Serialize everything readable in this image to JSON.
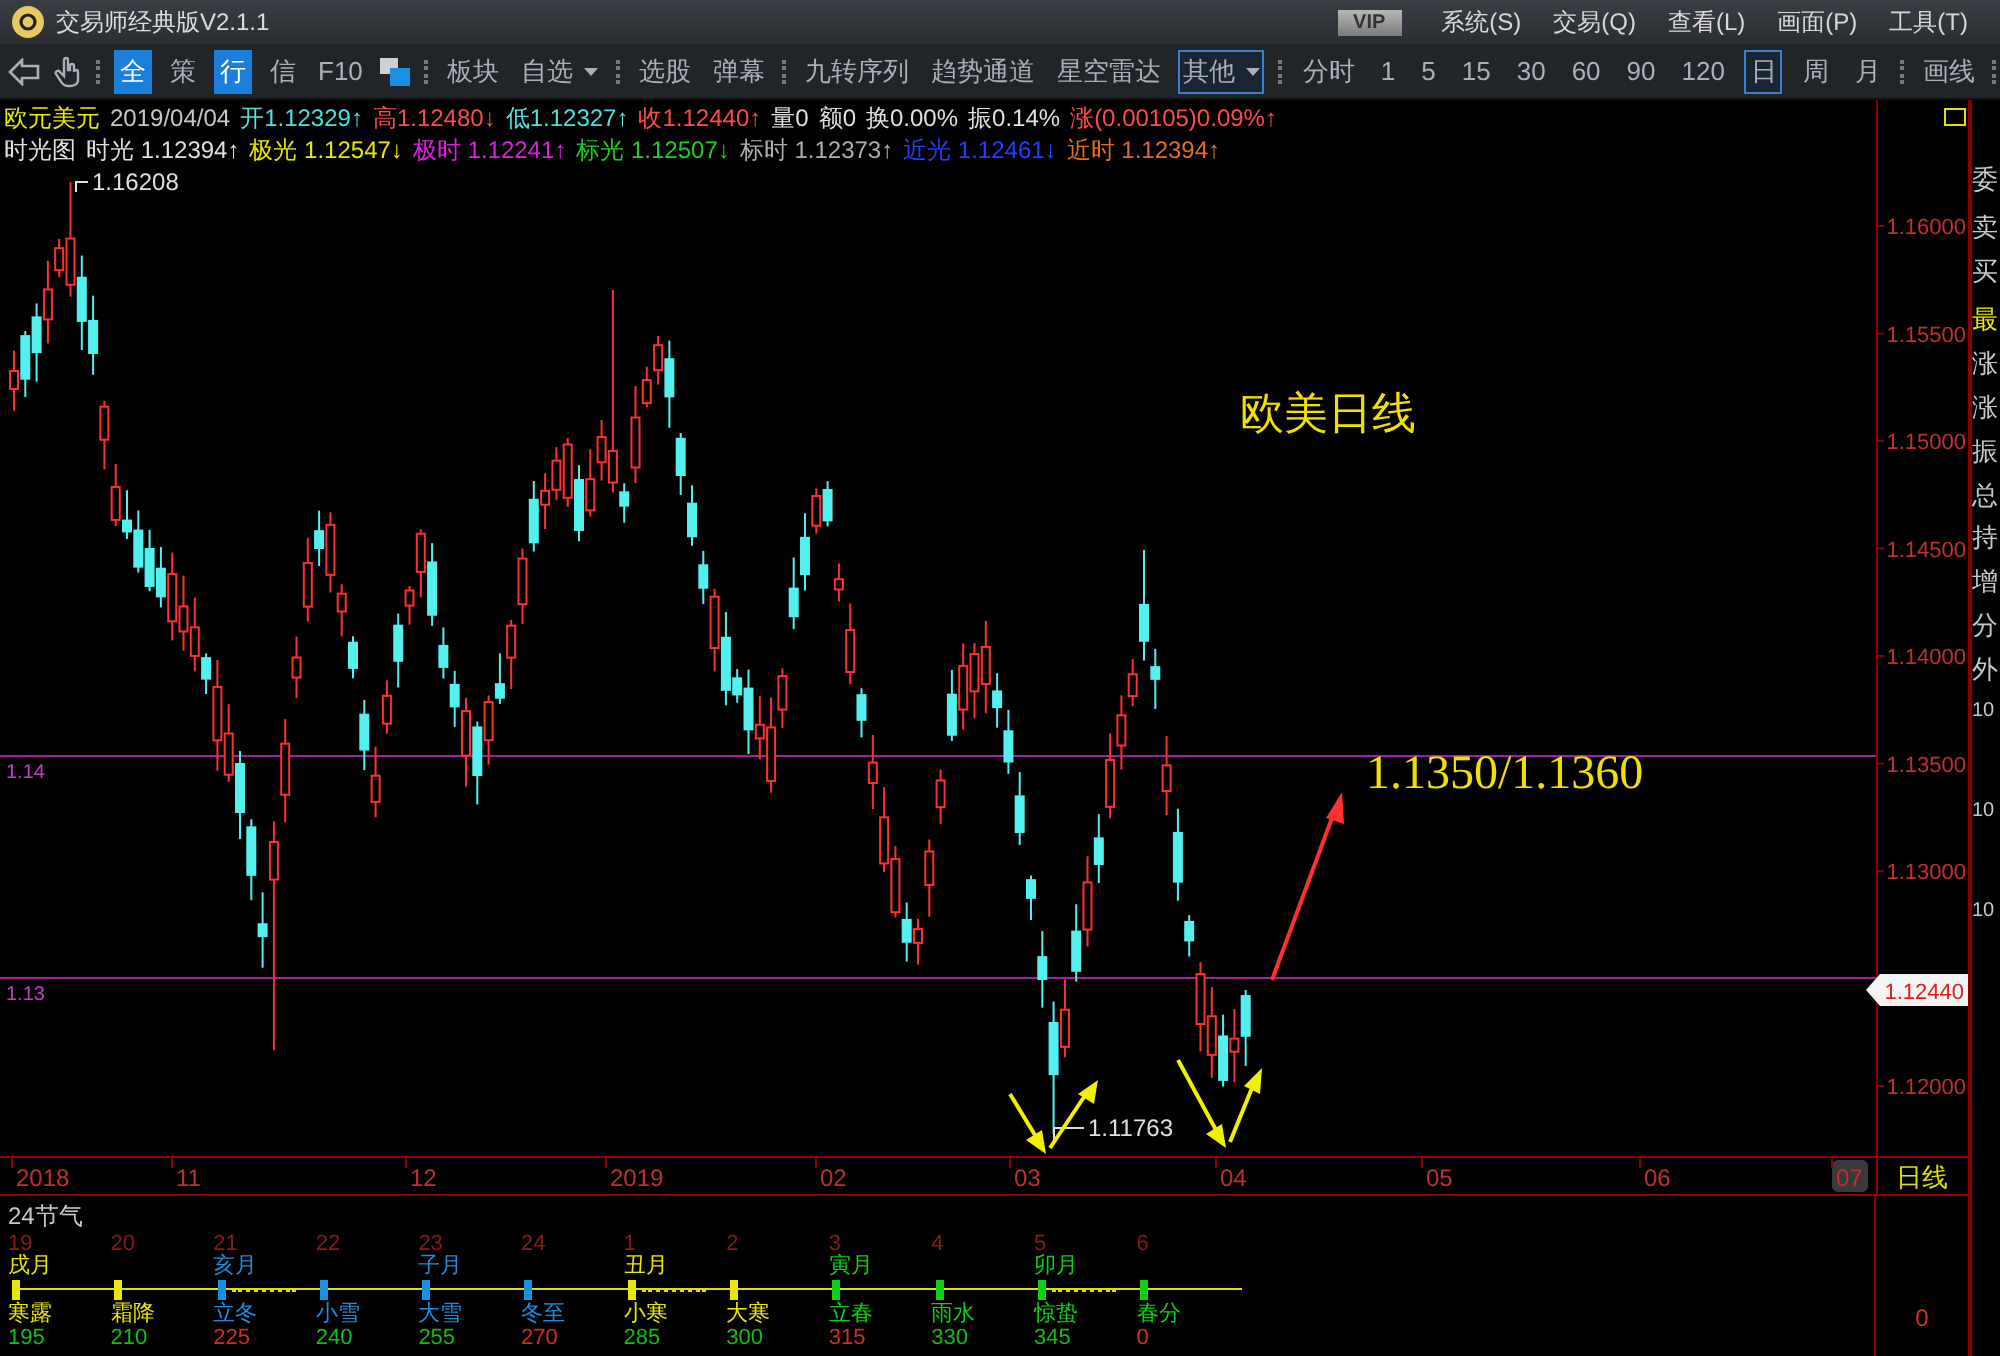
{
  "title_bar": {
    "title": "交易师经典版V2.1.1",
    "badge": "VIP",
    "menus": [
      "系统(S)",
      "交易(Q)",
      "查看(L)",
      "画面(P)",
      "工具(T)"
    ]
  },
  "toolbar": {
    "quick": [
      {
        "text": "全",
        "boxed": true
      },
      {
        "text": "策",
        "boxed": false
      },
      {
        "text": "行",
        "boxed": true
      },
      {
        "text": "信",
        "boxed": false
      },
      {
        "text": "F10",
        "boxed": false
      }
    ],
    "groups": [
      [
        {
          "text": "板块",
          "kind": "button",
          "selected": false
        },
        {
          "text": "自选",
          "kind": "dropdown",
          "selected": false
        }
      ],
      [
        {
          "text": "选股",
          "kind": "button",
          "selected": false
        },
        {
          "text": "弹幕",
          "kind": "button",
          "selected": false
        }
      ],
      [
        {
          "text": "九转序列",
          "kind": "button",
          "selected": false
        },
        {
          "text": "趋势通道",
          "kind": "button",
          "selected": false
        },
        {
          "text": "星空雷达",
          "kind": "button",
          "selected": false
        },
        {
          "text": "其他",
          "kind": "dropdown",
          "selected": true
        }
      ]
    ],
    "periods": [
      {
        "text": "分时",
        "selected": false
      },
      {
        "text": "1",
        "selected": false
      },
      {
        "text": "5",
        "selected": false
      },
      {
        "text": "15",
        "selected": false
      },
      {
        "text": "30",
        "selected": false
      },
      {
        "text": "60",
        "selected": false
      },
      {
        "text": "90",
        "selected": false
      },
      {
        "text": "120",
        "selected": false
      },
      {
        "text": "日",
        "selected": true
      },
      {
        "text": "周",
        "selected": false
      },
      {
        "text": "月",
        "selected": false
      }
    ],
    "draw": "画线"
  },
  "quote_line": [
    {
      "text": "欧元美元",
      "color": "#e8e800"
    },
    {
      "text": "2019/04/04",
      "color": "#c8c8c8"
    },
    {
      "text": "开1.12329↑",
      "color": "#4fe0e0"
    },
    {
      "text": "高1.12480↓",
      "color": "#ff4a4a"
    },
    {
      "text": "低1.12327↑",
      "color": "#4fe0e0"
    },
    {
      "text": "收1.12440↑",
      "color": "#ff4a4a"
    },
    {
      "text": "量0",
      "color": "#e0e0e0"
    },
    {
      "text": "额0",
      "color": "#e0e0e0"
    },
    {
      "text": "换0.00%",
      "color": "#e0e0e0"
    },
    {
      "text": "振0.14%",
      "color": "#e0e0e0"
    },
    {
      "text": "涨(0.00105)0.09%↑",
      "color": "#ff4a4a"
    }
  ],
  "indicator_line": [
    {
      "text": "时光图",
      "color": "#e0e0e0"
    },
    {
      "text": "时光 1.12394↑",
      "color": "#e0e0e0"
    },
    {
      "text": "极光 1.12547↓",
      "color": "#e8e800"
    },
    {
      "text": "极时 1.12241↑",
      "color": "#e020e0"
    },
    {
      "text": "标光 1.12507↓",
      "color": "#20d020"
    },
    {
      "text": "标时 1.12373↑",
      "color": "#b0b0b0"
    },
    {
      "text": "近光 1.12461↓",
      "color": "#2040ff"
    },
    {
      "text": "近时 1.12394↑",
      "color": "#e07020"
    }
  ],
  "chart": {
    "title": "欧美日线",
    "target": "1.1350/1.1360",
    "high_label": "1.16208",
    "low_label": "1.11763",
    "line_labels": [
      "1.14",
      "1.13"
    ],
    "yticks": [
      "1.16000",
      "1.15500",
      "1.15000",
      "1.14500",
      "1.14000",
      "1.13500",
      "1.13000",
      "1.12000"
    ],
    "last_price": "1.12440",
    "xlabels": [
      "2018",
      "11",
      "12",
      "2019",
      "02",
      "03",
      "04",
      "05",
      "06",
      "07"
    ],
    "corner": "日线"
  },
  "side_panel": {
    "labels": [
      {
        "text": "委",
        "highlight": false
      },
      {
        "text": "卖",
        "highlight": false
      },
      {
        "text": "买",
        "highlight": false
      },
      {
        "text": "最",
        "highlight": true
      },
      {
        "text": "涨",
        "highlight": false
      },
      {
        "text": "涨",
        "highlight": false
      },
      {
        "text": "振",
        "highlight": false
      },
      {
        "text": "总",
        "highlight": false
      },
      {
        "text": "持",
        "highlight": false
      },
      {
        "text": "增",
        "highlight": false
      },
      {
        "text": "分",
        "highlight": false
      },
      {
        "text": "外",
        "highlight": false
      }
    ],
    "values": [
      "10",
      "10",
      "10"
    ]
  },
  "solar_panel": {
    "title": "24节气",
    "axis_value": "0",
    "terms": [
      {
        "number": "19",
        "month": "戌月",
        "name": "寒露",
        "degree": "195",
        "color": "#e8e800",
        "dotted": false,
        "emphasis": false
      },
      {
        "number": "20",
        "name": "霜降",
        "degree": "210",
        "color": "#e8e800",
        "dotted": false,
        "emphasis": false
      },
      {
        "number": "21",
        "month": "亥月",
        "name": "立冬",
        "degree": "225",
        "color": "#1a90e0",
        "dotted": true,
        "emphasis": true
      },
      {
        "number": "22",
        "name": "小雪",
        "degree": "240",
        "color": "#1a90e0",
        "dotted": false,
        "emphasis": false
      },
      {
        "number": "23",
        "month": "子月",
        "name": "大雪",
        "degree": "255",
        "color": "#1a90e0",
        "dotted": false,
        "emphasis": false
      },
      {
        "number": "24",
        "name": "冬至",
        "degree": "270",
        "color": "#1a90e0",
        "dotted": false,
        "emphasis": true
      },
      {
        "number": "1",
        "month": "丑月",
        "name": "小寒",
        "degree": "285",
        "color": "#e8e800",
        "dotted": true,
        "emphasis": false
      },
      {
        "number": "2",
        "name": "大寒",
        "degree": "300",
        "color": "#e8e800",
        "dotted": false,
        "emphasis": false
      },
      {
        "number": "3",
        "month": "寅月",
        "name": "立春",
        "degree": "315",
        "color": "#10d010",
        "dotted": false,
        "emphasis": true
      },
      {
        "number": "4",
        "name": "雨水",
        "degree": "330",
        "color": "#10d010",
        "dotted": false,
        "emphasis": false
      },
      {
        "number": "5",
        "month": "卯月",
        "name": "惊蛰",
        "degree": "345",
        "color": "#10d010",
        "dotted": true,
        "emphasis": false
      },
      {
        "number": "6",
        "name": "春分",
        "degree": "0",
        "color": "#10d010",
        "dotted": false,
        "emphasis": true
      }
    ]
  }
}
